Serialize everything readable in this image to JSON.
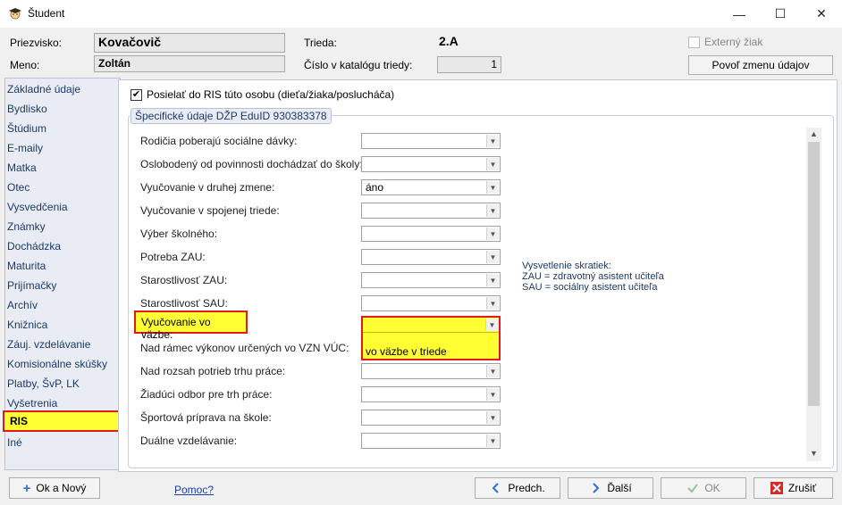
{
  "window": {
    "title": "Študent",
    "minimize": "—",
    "maximize": "☐",
    "close": "✕"
  },
  "header": {
    "surname_label": "Priezvisko:",
    "surname_value": "Kovačovič",
    "name_label": "Meno:",
    "name_value": "Zoltán",
    "class_label": "Trieda:",
    "class_value": "2.A",
    "catalog_label": "Číslo v katalógu triedy:",
    "catalog_value": "1",
    "external_label": "Externý žiak",
    "allow_change_label": "Povoľ zmenu údajov"
  },
  "sidebar": {
    "items": [
      "Základné údaje",
      "Bydlisko",
      "Štúdium",
      "E-maily",
      "Matka",
      "Otec",
      "Vysvedčenia",
      "Známky",
      "Dochádzka",
      "Maturita",
      "Prijímačky",
      "Archív",
      "Knižnica",
      "Záuj. vzdelávanie",
      "Komisionálne skúšky",
      "Platby, ŠvP, LK",
      "Vyšetrenia",
      "RIS",
      "Iné"
    ],
    "active": "RIS"
  },
  "panel": {
    "send_checkbox_label": "Posielať do RIS túto osobu (dieťa/žiaka/poslucháča)",
    "group_title": "Špecifické údaje DŽP EduID 930383378",
    "rows": [
      {
        "label": "Rodičia poberajú sociálne dávky:",
        "value": ""
      },
      {
        "label": "Oslobodený od povinnosti dochádzať do školy:",
        "value": ""
      },
      {
        "label": "Vyučovanie v druhej zmene:",
        "value": "áno"
      },
      {
        "label": "Vyučovanie v spojenej triede:",
        "value": ""
      },
      {
        "label": "Výber školného:",
        "value": ""
      },
      {
        "label": "Potreba ZAU:",
        "value": ""
      },
      {
        "label": "Starostlivosť ZAU:",
        "value": ""
      },
      {
        "label": "Starostlivosť SAU:",
        "value": ""
      },
      {
        "label": "Vyučovanie vo väzbe:",
        "value": ""
      },
      {
        "label": "Nad rámec výkonov určených vo VZN VÚC:",
        "value": ""
      },
      {
        "label": "Nad rozsah potrieb trhu práce:",
        "value": ""
      },
      {
        "label": "Žiadúci odbor pre trh práce:",
        "value": ""
      },
      {
        "label": "Športová príprava na škole:",
        "value": ""
      },
      {
        "label": "Duálne vzdelávanie:",
        "value": ""
      }
    ],
    "dropdown_option": "vo väzbe v triede",
    "note_title": "Vysvetlenie skratiek:",
    "note_line1": "ZAU = zdravotný asistent učiteľa",
    "note_line2": "SAU = sociálny asistent učiteľa"
  },
  "footer": {
    "ok_new": "Ok a Nový",
    "help": "Pomoc?",
    "prev": "Predch.",
    "next": "Ďalší",
    "ok": "OK",
    "cancel": "Zrušiť"
  },
  "colors": {
    "highlight": "#ffff33",
    "highlight_border": "#e01a1a",
    "link": "#1a3faa"
  }
}
